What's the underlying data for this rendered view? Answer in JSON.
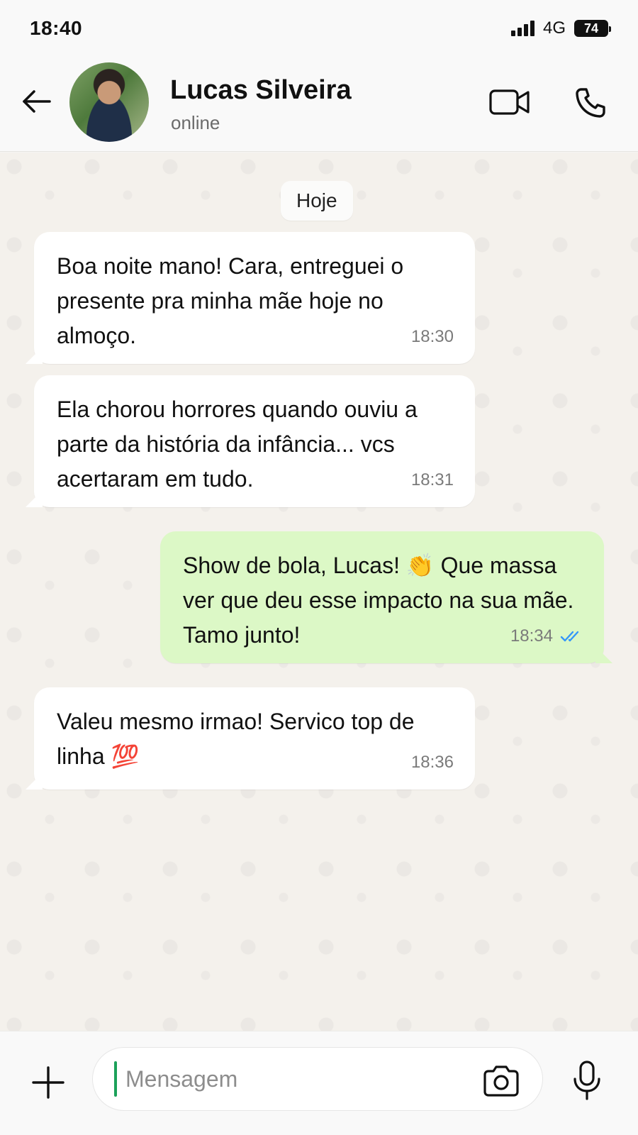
{
  "status_bar": {
    "time": "18:40",
    "network": "4G",
    "battery": "74"
  },
  "header": {
    "contact_name": "Lucas Silveira",
    "contact_status": "online",
    "icons": [
      "back-arrow-icon",
      "video-call-icon",
      "phone-icon"
    ]
  },
  "chat": {
    "date_label": "Hoje",
    "messages": [
      {
        "direction": "incoming",
        "text": "Boa noite mano! Cara, entreguei o presente pra minha mãe hoje no almoço.",
        "time": "18:30"
      },
      {
        "direction": "incoming",
        "text": "Ela chorou horrores quando ouviu a parte da história da infância... vcs acertaram em tudo.",
        "time": "18:31"
      },
      {
        "direction": "outgoing",
        "text": "Show de bola, Lucas! 👏 Que massa ver que deu esse impacto na sua mãe. Tamo junto!",
        "time": "18:34",
        "read_receipt": "double-check-read"
      },
      {
        "direction": "incoming",
        "text": "Valeu mesmo irmao! Servico top de linha 💯",
        "time": "18:36"
      }
    ]
  },
  "composer": {
    "placeholder": "Mensagem",
    "value": ""
  },
  "colors": {
    "incoming_bubble": "#ffffff",
    "outgoing_bubble": "#dcf8c6",
    "read_tick": "#3497f9",
    "cursor": "#1ca15a"
  }
}
